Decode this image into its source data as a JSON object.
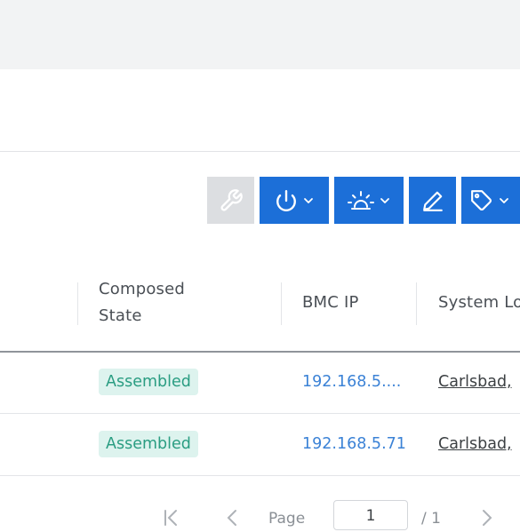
{
  "toolbar": {
    "buttons": [
      {
        "name": "wrench",
        "icon": "wrench-icon",
        "color": "#dcdee1",
        "dropdown": false
      },
      {
        "name": "power",
        "icon": "power-icon",
        "color": "#1c6fd8",
        "dropdown": true
      },
      {
        "name": "beacon",
        "icon": "beacon-light-icon",
        "color": "#1c6fd8",
        "dropdown": true
      },
      {
        "name": "edit",
        "icon": "pencil-icon",
        "color": "#1c6fd8",
        "dropdown": false
      },
      {
        "name": "tag",
        "icon": "tag-icon",
        "color": "#1c6fd8",
        "dropdown": true
      }
    ]
  },
  "table": {
    "columns": [
      "Composed\nState",
      "BMC IP",
      "System Lo"
    ],
    "rows": [
      {
        "composed_state": "Assembled",
        "bmc_ip": "192.168.5....",
        "system_location": "Carlsbad,"
      },
      {
        "composed_state": "Assembled",
        "bmc_ip": "192.168.5.71",
        "system_location": "Carlsbad,"
      }
    ]
  },
  "pagination": {
    "first_icon": "first-page-icon",
    "prev_icon": "prev-page-icon",
    "label": "Page",
    "current": "1",
    "total": "/ 1",
    "next_icon": "next-page-icon"
  },
  "colors": {
    "primary": "#1c6fd8",
    "badge_bg": "#ddf3ee",
    "badge_text": "#2a9d82",
    "link": "#3b82d6"
  }
}
